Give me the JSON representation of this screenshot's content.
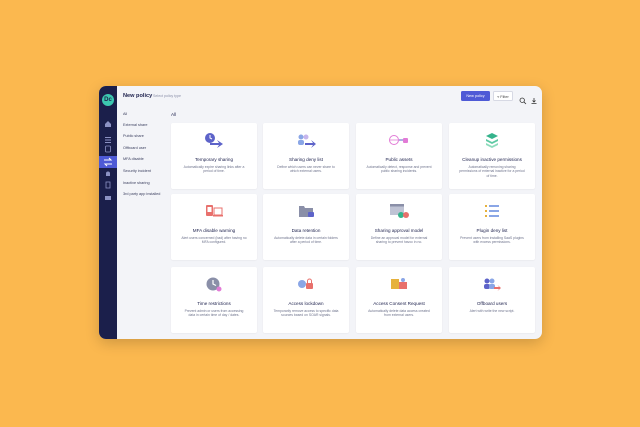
{
  "header": {
    "title": "New policy",
    "subtitle": "Select policy type",
    "new_policy_button": "New policy",
    "filter_button": "Filter"
  },
  "filters": [
    "All",
    "External share",
    "Public share",
    "Offboard user",
    "MFA disable",
    "Security incident",
    "Inactive sharing",
    "3rd party app installed"
  ],
  "main": {
    "section_label": "All",
    "cards": [
      {
        "title": "Temporary sharing",
        "desc": "Automatically expire sharing links after a period of time."
      },
      {
        "title": "Sharing deny list",
        "desc": "Define which users can never share to which external users."
      },
      {
        "title": "Public assets",
        "desc": "Automatically detect, response and prevent public sharing incidents."
      },
      {
        "title": "Cleanup inactive permissions",
        "desc": "Automatically removing sharing permissions of external inactive for a period of time."
      },
      {
        "title": "MFA disable warning",
        "desc": "Alert users concerned (bad) after having no MFA configured."
      },
      {
        "title": "Data retention",
        "desc": "Automatically delete data in certain folders after a period of time."
      },
      {
        "title": "Sharing approval model",
        "desc": "Define an approval model for external sharing to prevent havoc in no."
      },
      {
        "title": "Plugin deny list",
        "desc": "Prevent users from installing SaaS plugins with excess permissions."
      },
      {
        "title": "Time restrictions",
        "desc": "Prevent admin or users from accessing data in certain time of day / dates."
      },
      {
        "title": "Access lockdown",
        "desc": "Temporarily remove access to specific data sources based on SOAR signals."
      },
      {
        "title": "Access Consent Request",
        "desc": "Automatically delete data access created from external users."
      },
      {
        "title": "Offboard users",
        "desc": "Alert with write the new script."
      }
    ]
  },
  "colors": {
    "background": "#fbb84f",
    "rail": "#1b1f4b",
    "accent": "#4e5ad6",
    "logo": "#3cc7b0"
  },
  "rail_icons": [
    "home-icon",
    "list-icon",
    "database-icon",
    "transfer-icon",
    "bell-icon",
    "document-icon",
    "monitor-icon"
  ]
}
